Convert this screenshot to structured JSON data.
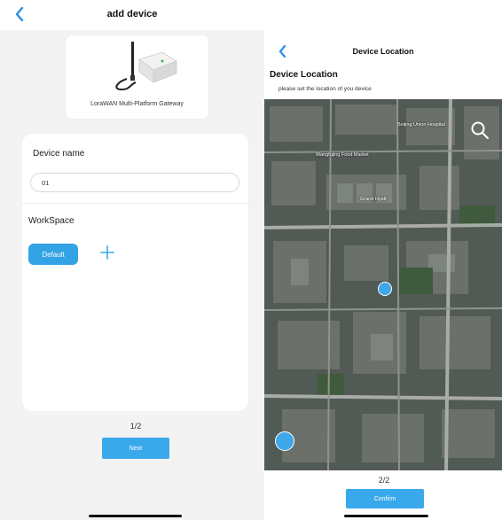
{
  "left": {
    "header": {
      "title": "add device"
    },
    "product": {
      "name": "LoraWAN Multi-Platform Gateway"
    },
    "form": {
      "device_name_label": "Device name",
      "device_name_value": "01",
      "workspace_label": "WorkSpace",
      "workspace_chip": "Default"
    },
    "pager": "1/2",
    "next_button": "Next"
  },
  "right": {
    "header": {
      "title": "Device Location"
    },
    "section_title": "Device Location",
    "section_desc": "please set the location of you device",
    "map_labels": [
      "Beijing Union Hospital",
      "Wangfujing Food Market",
      "Grand Hyatt"
    ],
    "pager": "2/2",
    "confirm_button": "Confirm"
  },
  "colors": {
    "accent": "#39a9ec",
    "chip": "#34a3e6",
    "back_icon": "#2a8ee8"
  }
}
